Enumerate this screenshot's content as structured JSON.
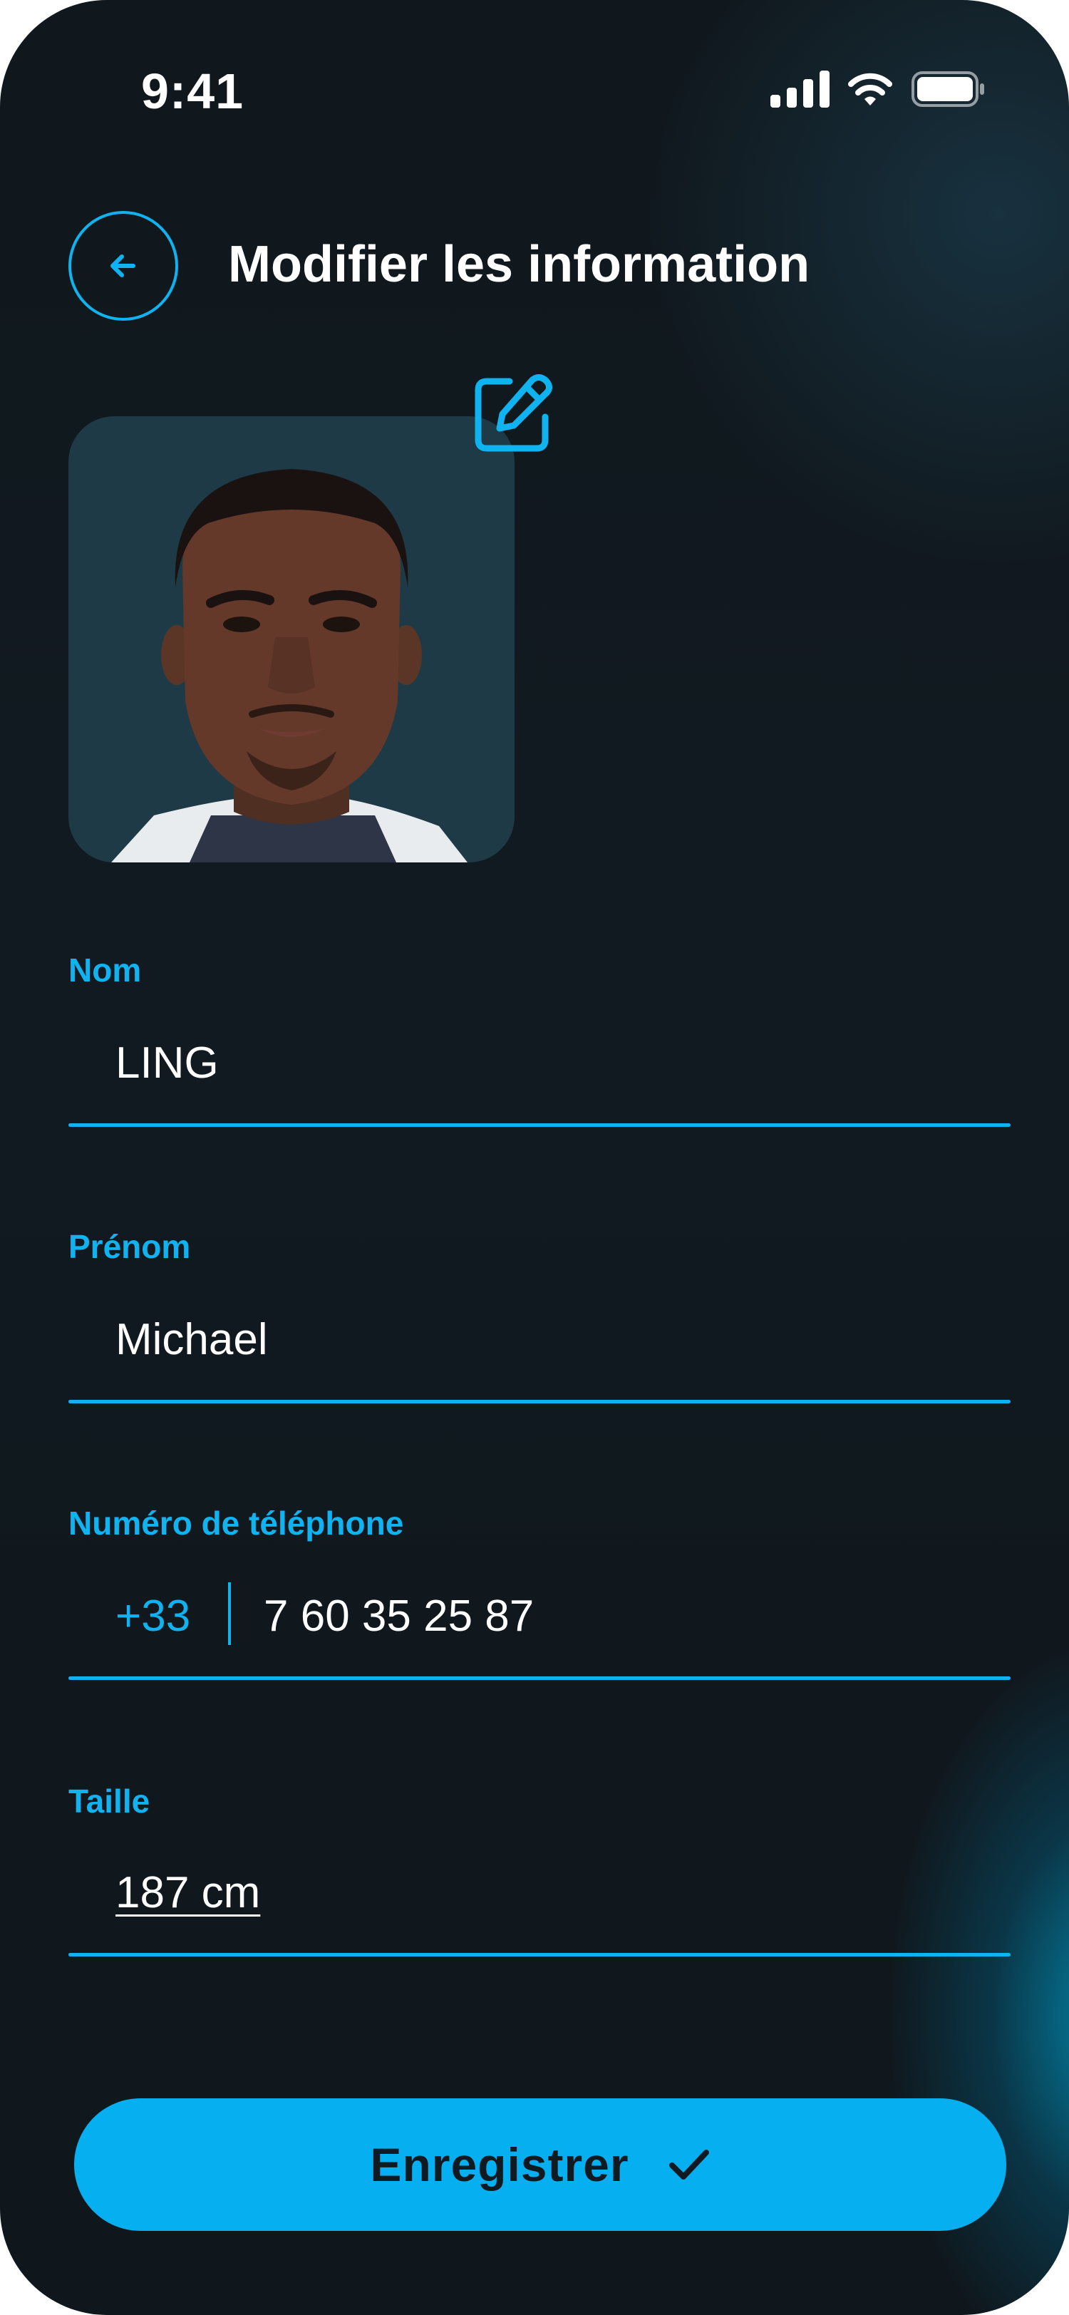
{
  "status_bar": {
    "time": "9:41",
    "icons": [
      "cellular-signal-icon",
      "wifi-icon",
      "battery-icon"
    ]
  },
  "header": {
    "back_icon": "arrow-left-icon",
    "title": "Modifier les information"
  },
  "profile": {
    "edit_icon": "edit-pencil-icon"
  },
  "form": {
    "nom": {
      "label": "Nom",
      "value": "LING"
    },
    "prenom": {
      "label": "Prénom",
      "value": "Michael"
    },
    "telephone": {
      "label": "Numéro de téléphone",
      "dial_code": "+33",
      "value": "7 60 35 25 87"
    },
    "taille": {
      "label": "Taille",
      "value": "187 cm"
    }
  },
  "actions": {
    "save_label": "Enregistrer",
    "save_icon": "checkmark-icon"
  },
  "colors": {
    "accent": "#10b2ef",
    "button": "#06b0f0",
    "background": "#10181d",
    "text": "#ffffff"
  }
}
